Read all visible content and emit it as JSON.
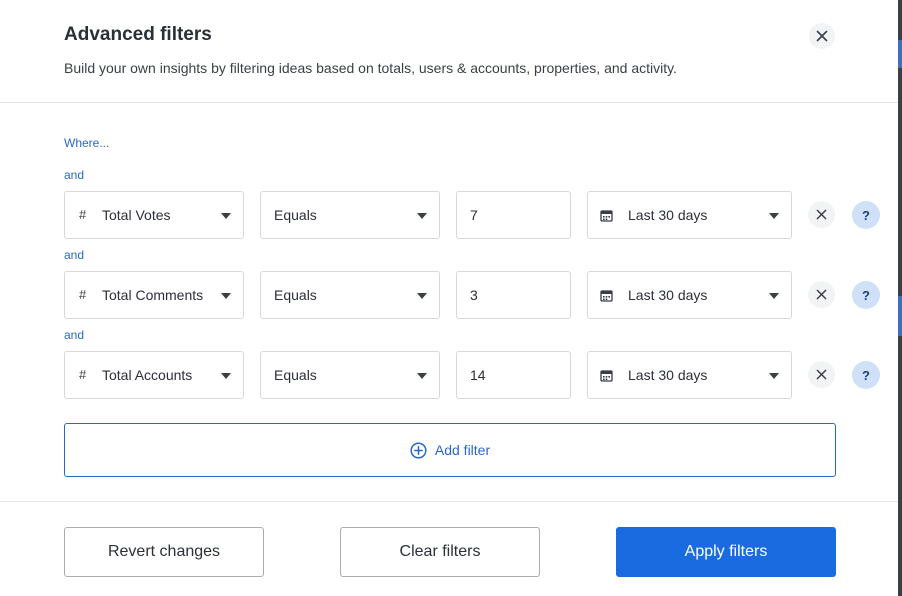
{
  "dialog": {
    "title": "Advanced filters",
    "subtitle": "Build your own insights by filtering ideas based on totals, users & accounts, properties, and activity."
  },
  "where_label": "Where...",
  "conjunction": "and",
  "filters": [
    {
      "metric": "Total Votes",
      "operator": "Equals",
      "value": "7",
      "range": "Last 30 days"
    },
    {
      "metric": "Total Comments",
      "operator": "Equals",
      "value": "3",
      "range": "Last 30 days"
    },
    {
      "metric": "Total Accounts",
      "operator": "Equals",
      "value": "14",
      "range": "Last 30 days"
    }
  ],
  "metric_icon": "#",
  "help_label": "?",
  "add_filter_label": "Add filter",
  "footer": {
    "revert_label": "Revert changes",
    "clear_label": "Clear filters",
    "apply_label": "Apply filters"
  },
  "colors": {
    "accent": "#1a6be0",
    "link": "#2a68c8",
    "help_bg": "#cfe0f7"
  }
}
